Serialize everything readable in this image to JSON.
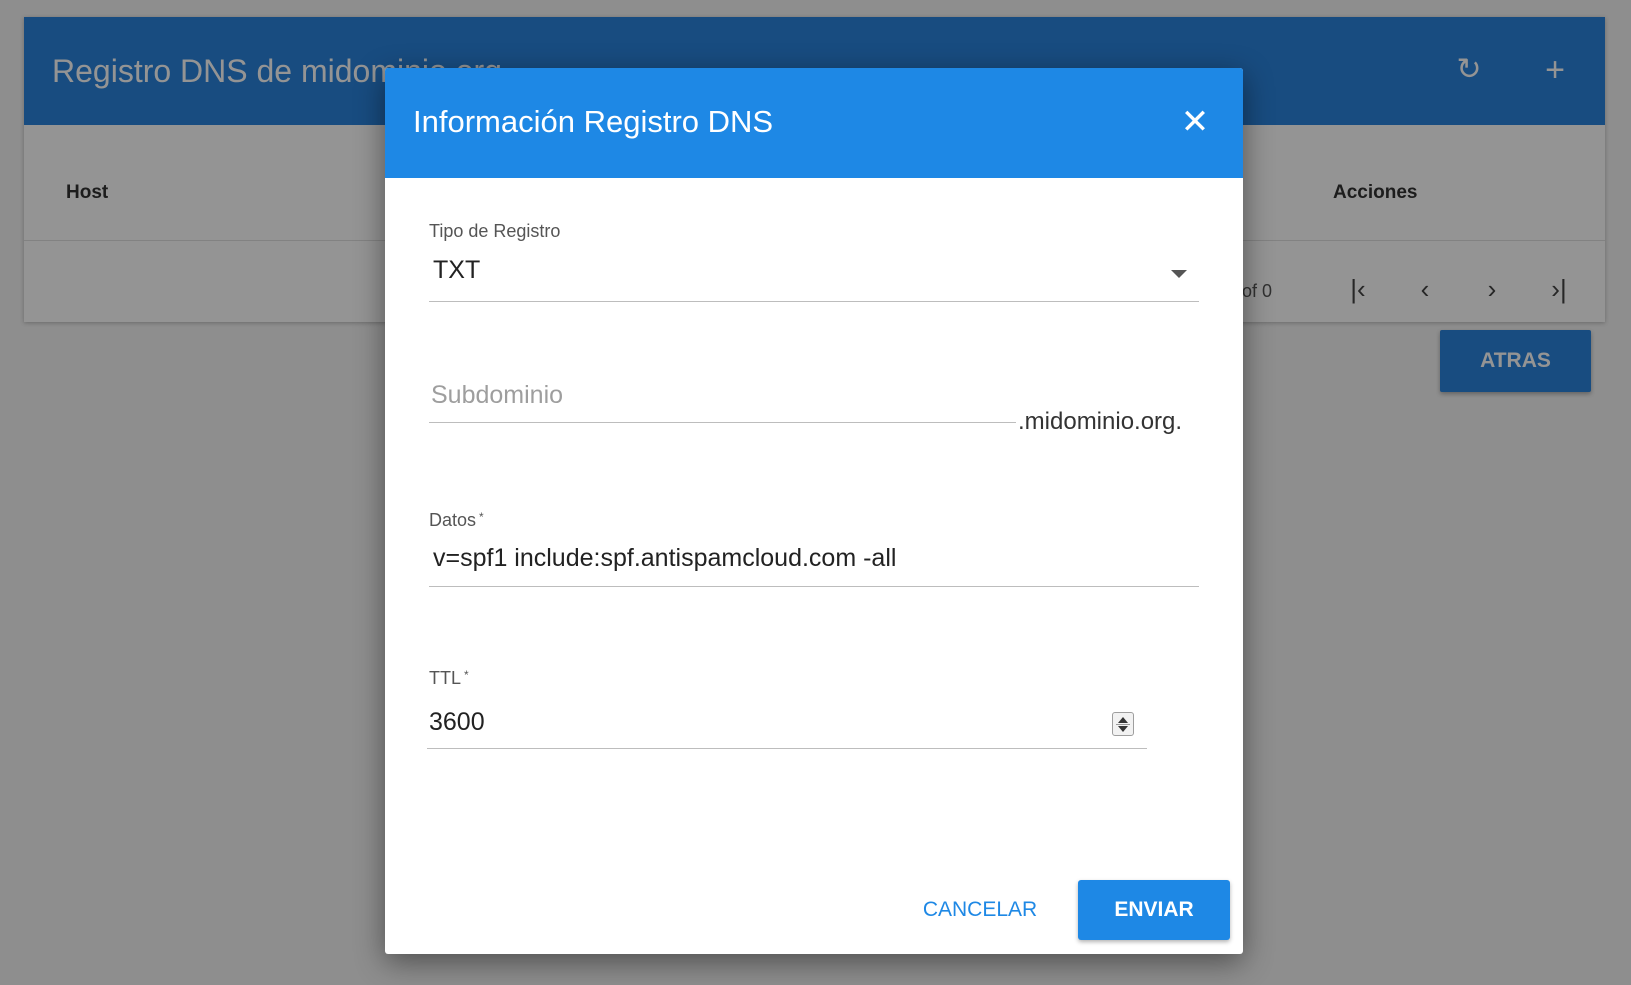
{
  "card": {
    "title": "Registro DNS de midominio.org.",
    "refresh_icon": "refresh-icon",
    "add_icon": "plus-icon",
    "columns": {
      "host": "Host",
      "actions": "Acciones"
    },
    "pager": {
      "range_text": "of 0",
      "first_icon": "first-page-icon",
      "prev_icon": "chevron-left-icon",
      "next_icon": "chevron-right-icon",
      "last_icon": "last-page-icon"
    },
    "back_label": "ATRAS"
  },
  "dialog": {
    "title": "Información Registro DNS",
    "close_icon": "close-icon",
    "record_type": {
      "label": "Tipo de Registro",
      "value": "TXT"
    },
    "subdomain": {
      "placeholder": "Subdominio",
      "suffix": ".midominio.org."
    },
    "data": {
      "label": "Datos",
      "required_mark": "*",
      "value": "v=spf1 include:spf.antispamcloud.com -all"
    },
    "ttl": {
      "label": "TTL",
      "required_mark": "*",
      "value": "3600"
    },
    "cancel_label": "CANCELAR",
    "send_label": "ENVIAR"
  },
  "colors": {
    "header_blue": "#2a84dc",
    "dialog_blue": "#1e88e5"
  }
}
